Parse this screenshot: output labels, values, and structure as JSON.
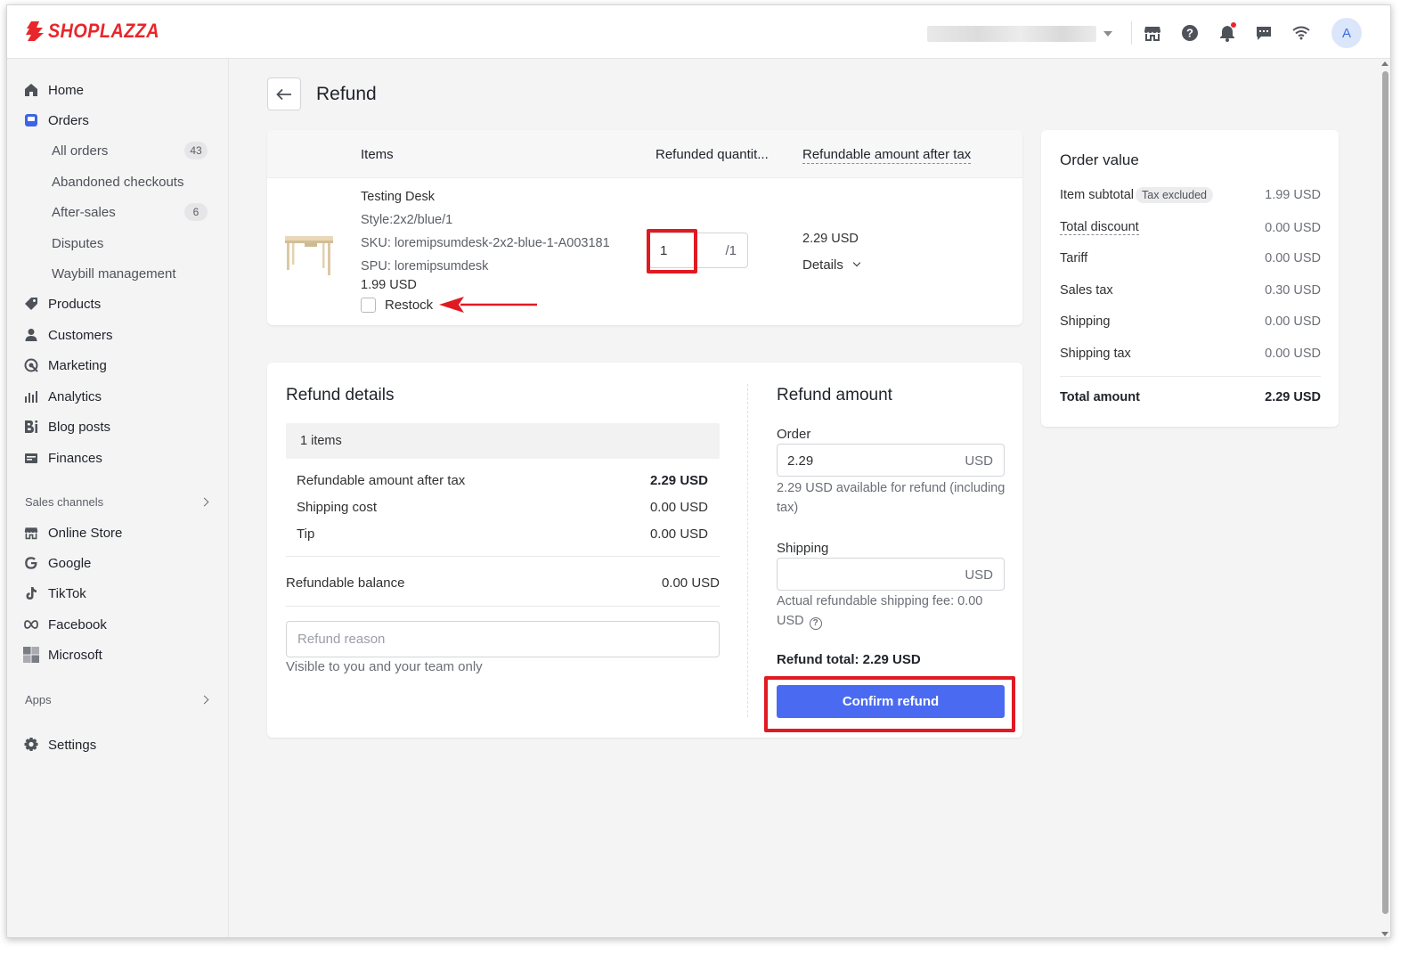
{
  "brand": {
    "name": "SHOPLAZZA",
    "color": "#e8262b"
  },
  "topbar": {
    "icons": [
      "store-icon",
      "help-icon",
      "bell-icon",
      "chat-icon",
      "wifi-icon"
    ],
    "avatar_initial": "A"
  },
  "sidebar": {
    "items": [
      {
        "label": "Home",
        "icon": "home-icon"
      },
      {
        "label": "Orders",
        "icon": "orders-icon"
      },
      {
        "label": "Products",
        "icon": "tag-icon"
      },
      {
        "label": "Customers",
        "icon": "person-icon"
      },
      {
        "label": "Marketing",
        "icon": "marketing-icon"
      },
      {
        "label": "Analytics",
        "icon": "bar-chart-icon"
      },
      {
        "label": "Blog posts",
        "icon": "blog-icon"
      },
      {
        "label": "Finances",
        "icon": "finance-icon"
      }
    ],
    "order_subitems": [
      {
        "label": "All orders",
        "badge": "43"
      },
      {
        "label": "Abandoned checkouts",
        "badge": ""
      },
      {
        "label": "After-sales",
        "badge": "6"
      },
      {
        "label": "Disputes",
        "badge": ""
      },
      {
        "label": "Waybill management",
        "badge": ""
      }
    ],
    "sales_channels_label": "Sales channels",
    "channels": [
      {
        "label": "Online Store",
        "icon": "store-icon"
      },
      {
        "label": "Google",
        "icon": "google-icon"
      },
      {
        "label": "TikTok",
        "icon": "tiktok-icon"
      },
      {
        "label": "Facebook",
        "icon": "meta-icon"
      },
      {
        "label": "Microsoft",
        "icon": "microsoft-icon"
      }
    ],
    "apps_label": "Apps",
    "settings_label": "Settings"
  },
  "page": {
    "title": "Refund"
  },
  "items_table": {
    "headers": {
      "items": "Items",
      "quantity": "Refunded quantit...",
      "amount": "Refundable amount after tax"
    },
    "product": {
      "name": "Testing Desk",
      "style": "Style:2x2/blue/1",
      "sku": "SKU: loremipsumdesk-2x2-blue-1-A003181",
      "spu": "SPU: loremipsumdesk",
      "price": "1.99 USD",
      "restock_label": "Restock",
      "restock_checked": false,
      "quantity": "1",
      "quantity_total": "/1",
      "refundable_amount": "2.29 USD",
      "details_label": "Details"
    }
  },
  "refund_details": {
    "title": "Refund details",
    "items_count": "1 items",
    "rows": [
      {
        "label": "Refundable amount after tax",
        "value": "2.29 USD"
      },
      {
        "label": "Shipping cost",
        "value": "0.00 USD"
      },
      {
        "label": "Tip",
        "value": "0.00 USD"
      }
    ],
    "balance_label": "Refundable balance",
    "balance_value": "0.00 USD",
    "reason_placeholder": "Refund reason",
    "reason_help": "Visible to you and your team only"
  },
  "refund_amount": {
    "title": "Refund amount",
    "order_label": "Order",
    "order_value": "2.29",
    "currency": "USD",
    "order_help": "2.29 USD available for refund (including tax)",
    "shipping_label": "Shipping",
    "shipping_value": "",
    "shipping_help": "Actual refundable shipping fee: 0.00 USD",
    "total": "Refund total: 2.29 USD",
    "confirm_label": "Confirm refund",
    "button_color": "#4a6bf1"
  },
  "order_value": {
    "title": "Order value",
    "rows": [
      {
        "label": "Item subtotal",
        "pill": "Tax excluded",
        "value": "1.99 USD"
      },
      {
        "label": "Total discount",
        "value": "0.00 USD"
      },
      {
        "label": "Tariff",
        "value": "0.00 USD"
      },
      {
        "label": "Sales tax",
        "value": "0.30 USD"
      },
      {
        "label": "Shipping",
        "value": "0.00 USD"
      },
      {
        "label": "Shipping tax",
        "value": "0.00 USD"
      }
    ],
    "total_label": "Total amount",
    "total_value": "2.29 USD"
  },
  "annotation_color": "#e01a22"
}
